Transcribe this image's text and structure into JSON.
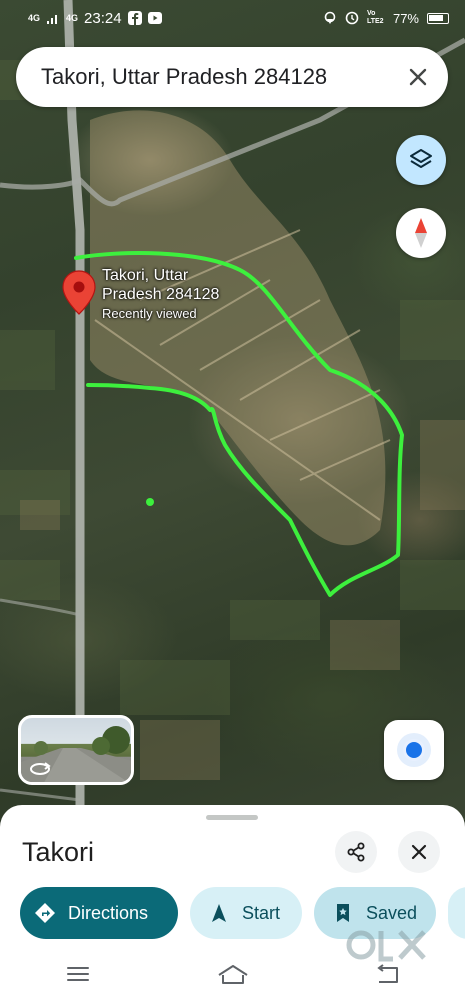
{
  "status_bar": {
    "signal_1": "4G",
    "signal_2": "4G",
    "time": "23:24",
    "volte": "Vo LTE2",
    "battery": "77%",
    "icons": [
      "signal-icon",
      "facebook-icon",
      "youtube-icon",
      "location-icon",
      "alarm-icon",
      "battery-icon"
    ]
  },
  "search": {
    "query": "Takori, Uttar Pradesh 284128",
    "close_icon": "close-icon"
  },
  "map": {
    "pin": {
      "title": "Takori, Uttar Pradesh 284128",
      "subtitle": "Recently viewed",
      "color": "#ea4335"
    },
    "boundary_color": "#3df03d",
    "layers_icon": "layers-icon",
    "compass_icon": "compass-icon",
    "location_icon": "my-location-icon"
  },
  "sheet": {
    "title": "Takori",
    "actions": {
      "directions": "Directions",
      "start": "Start",
      "saved": "Saved"
    },
    "accent": "#0b6a78"
  },
  "watermark": "OLX",
  "nav": {
    "icons": [
      "menu-icon",
      "home-icon",
      "back-icon"
    ]
  }
}
